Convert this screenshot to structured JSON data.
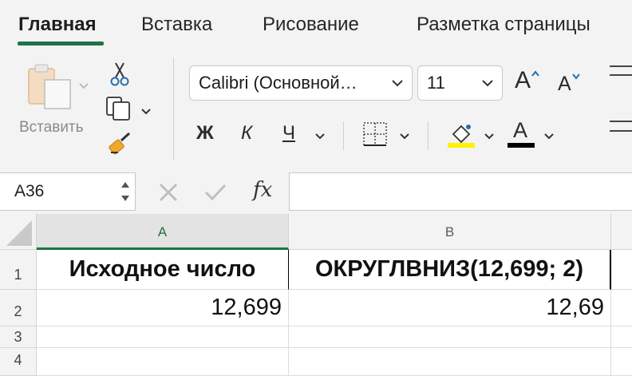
{
  "tabs": [
    {
      "label": "Главная",
      "active": true
    },
    {
      "label": "Вставка",
      "active": false
    },
    {
      "label": "Рисование",
      "active": false
    },
    {
      "label": "Разметка страницы",
      "active": false
    }
  ],
  "ribbon": {
    "paste_label": "Вставить",
    "font_name": "Calibri (Основной…",
    "font_size": "11",
    "grow_font": "A",
    "shrink_font": "A",
    "bold": "Ж",
    "italic": "К",
    "underline": "Ч",
    "font_color_letter": "A",
    "colors": {
      "highlight": "#fff200",
      "font_color": "#000000",
      "accent": "#1f7245"
    }
  },
  "formula_bar": {
    "name_box": "A36",
    "fx_label": "fx",
    "formula": ""
  },
  "sheet": {
    "columns": [
      "A",
      "B"
    ],
    "selected_column": "A",
    "rows": [
      {
        "row": "1",
        "cells": [
          "Исходное число",
          "ОКРУГЛВНИЗ(12,699; 2)"
        ]
      },
      {
        "row": "2",
        "cells": [
          "12,699",
          "12,69"
        ]
      },
      {
        "row": "3",
        "cells": [
          "",
          ""
        ]
      },
      {
        "row": "4",
        "cells": [
          "",
          ""
        ]
      }
    ]
  }
}
